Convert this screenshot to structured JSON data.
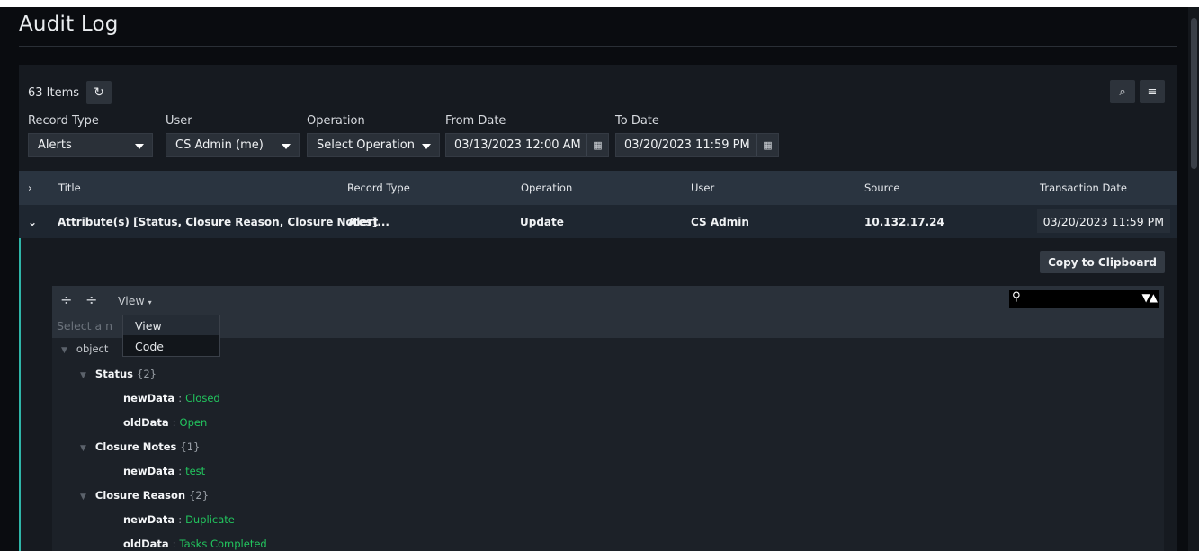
{
  "page": {
    "title": "Audit Log"
  },
  "toolbar": {
    "items_count": "63 Items"
  },
  "filters": {
    "record_type": {
      "label": "Record Type",
      "value": "Alerts"
    },
    "user": {
      "label": "User",
      "value": "CS Admin (me)"
    },
    "operation": {
      "label": "Operation",
      "value": "Select Operation"
    },
    "from_date": {
      "label": "From Date",
      "value": "03/13/2023 12:00 AM"
    },
    "to_date": {
      "label": "To Date",
      "value": "03/20/2023 11:59 PM"
    }
  },
  "grid": {
    "columns": [
      "Title",
      "Record Type",
      "Operation",
      "User",
      "Source",
      "Transaction Date"
    ],
    "row": {
      "title": "Attribute(s) [Status, Closure Reason, Closure Notes]...",
      "record_type": "Alert",
      "operation": "Update",
      "user": "CS Admin",
      "source": "10.132.17.24",
      "transaction_date": "03/20/2023 11:59 PM"
    }
  },
  "detail": {
    "copy_label": "Copy to Clipboard",
    "view_label": "View",
    "path_placeholder": "Select a n",
    "mode_options": [
      "View",
      "Code"
    ],
    "tree": {
      "root": "object",
      "status": {
        "key": "Status",
        "count": "{2}",
        "new_key": "newData",
        "new_val": "Closed",
        "old_key": "oldData",
        "old_val": "Open"
      },
      "closure_notes": {
        "key": "Closure Notes",
        "count": "{1}",
        "new_key": "newData",
        "new_val": "test"
      },
      "closure_reason": {
        "key": "Closure Reason",
        "count": "{2}",
        "new_key": "newData",
        "new_val": "Duplicate",
        "old_key": "oldData",
        "old_val": "Tasks Completed"
      },
      "separator": ":"
    }
  },
  "icons": {
    "refresh": "refresh-icon",
    "search": "search-icon",
    "menu": "menu-icon",
    "calendar": "calendar-icon",
    "expand_all": "expand-all-icon",
    "collapse_all": "collapse-all-icon"
  },
  "colors": {
    "accent": "#2fb5a8",
    "value_green": "#22c55e"
  }
}
